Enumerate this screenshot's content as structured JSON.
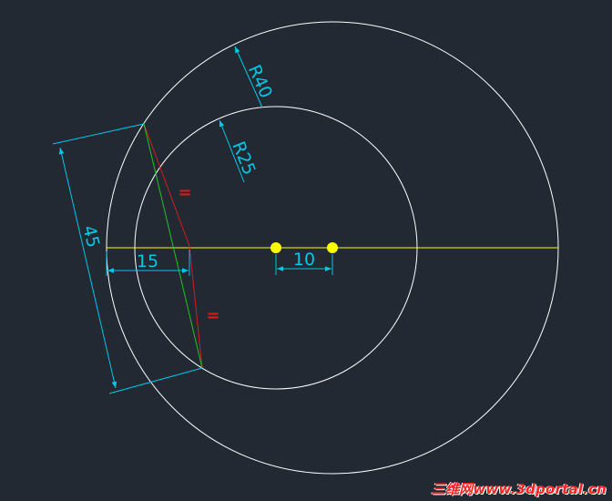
{
  "drawing": {
    "dimensions": {
      "outer_radius": "R40",
      "inner_radius": "R25",
      "chord_length": "45",
      "offset_from_circle": "15",
      "center_spacing": "10"
    },
    "equal_marks": [
      "=",
      "="
    ],
    "colors": {
      "background": "#222933",
      "circles": "#ffffff",
      "axis": "#ffff00",
      "center_points": "#ffff00",
      "dimensions": "#00c8e6",
      "constraint_lines": "#d81b1b",
      "chord": "#22c322"
    }
  },
  "watermark": "三维网www.3dportal.cn"
}
